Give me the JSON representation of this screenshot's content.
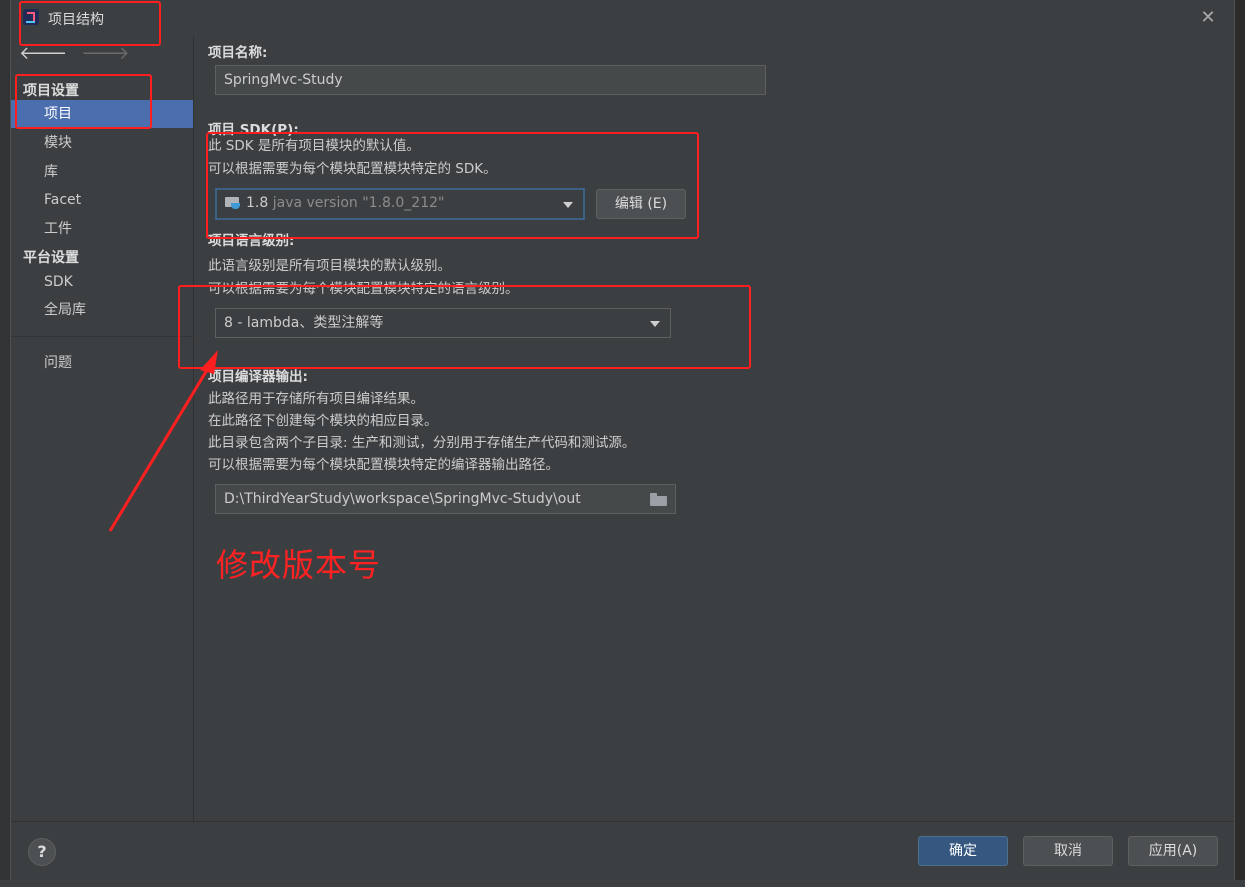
{
  "window": {
    "title": "项目结构",
    "close_glyph": "✕"
  },
  "nav": {
    "back": "🡐",
    "forward": "🡒"
  },
  "sidebar": {
    "project_settings_header": "项目设置",
    "project_items": [
      "项目",
      "模块",
      "库",
      "Facet",
      "工件"
    ],
    "platform_settings_header": "平台设置",
    "platform_items": [
      "SDK",
      "全局库"
    ],
    "problems": "问题",
    "selected": "项目"
  },
  "project_name": {
    "label": "项目名称:",
    "value": "SpringMvc-Study"
  },
  "project_sdk": {
    "label": "项目 SDK(P):",
    "desc1": "此 SDK 是所有项目模块的默认值。",
    "desc2": "可以根据需要为每个模块配置模块特定的 SDK。",
    "selected_version": "1.8",
    "selected_detail": "java version \"1.8.0_212\"",
    "edit_button": "编辑 (E)"
  },
  "language_level": {
    "label": "项目语言级别:",
    "desc1": "此语言级别是所有项目模块的默认级别。",
    "desc2": "可以根据需要为每个模块配置模块特定的语言级别。",
    "selected": "8 - lambda、类型注解等"
  },
  "compiler_output": {
    "label": "项目编译器输出:",
    "desc1": "此路径用于存储所有项目编译结果。",
    "desc2": "在此路径下创建每个模块的相应目录。",
    "desc3": "此目录包含两个子目录: 生产和测试，分别用于存储生产代码和测试源。",
    "desc4": "可以根据需要为每个模块配置模块特定的编译器输出路径。",
    "path": "D:\\ThirdYearStudy\\workspace\\SpringMvc-Study\\out"
  },
  "footer": {
    "help": "?",
    "ok": "确定",
    "cancel": "取消",
    "apply": "应用(A)"
  },
  "annotation": {
    "text": "修改版本号",
    "color": "#ff2222"
  },
  "colors": {
    "accent": "#4b6eaf",
    "primary_button": "#365880",
    "dialog_bg": "#3c3f41"
  }
}
